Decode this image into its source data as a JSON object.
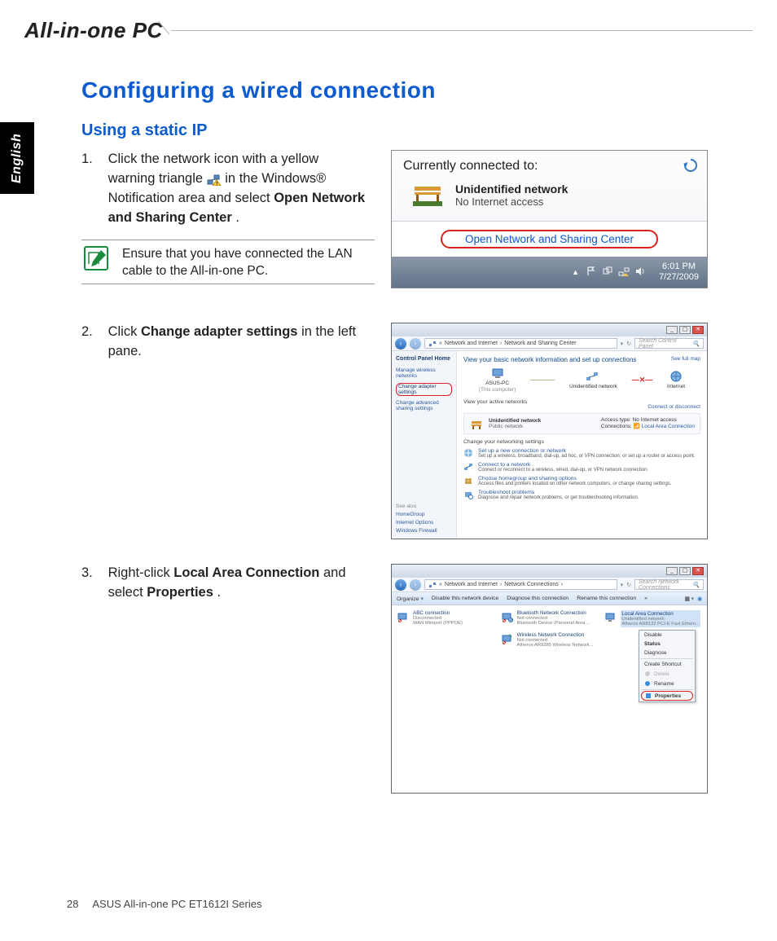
{
  "header": {
    "product_name": "All-in-one PC"
  },
  "lang_tab": "English",
  "h1": "Configuring a wired connection",
  "h2": "Using a static IP",
  "steps": {
    "s1": {
      "num": "1.",
      "text_a": "Click the network icon with a yellow warning triangle ",
      "text_b": " in the Windows® Notification area and select ",
      "bold": "Open Network and Sharing Center",
      "period": "."
    },
    "s2": {
      "num": "2.",
      "text_a": "Click ",
      "bold": "Change adapter settings",
      "text_b": " in the left pane."
    },
    "s3": {
      "num": "3.",
      "text_a": "Right-click ",
      "bold1": "Local Area Connection",
      "text_b": " and select ",
      "bold2": "Properties",
      "period": "."
    }
  },
  "note": "Ensure that you have connected the LAN cable to the All-in-one PC.",
  "shot1": {
    "title": "Currently connected to:",
    "net_name": "Unidentified network",
    "net_sub": "No Internet access",
    "link": "Open Network and Sharing Center",
    "clock_time": "6:01 PM",
    "clock_date": "7/27/2009"
  },
  "shot2": {
    "breadcrumb_a": "Network and Internet",
    "breadcrumb_b": "Network and Sharing Center",
    "search_ph": "Search Control Panel",
    "cph": "Control Panel Home",
    "left_links": {
      "manage": "Manage wireless networks",
      "change_adapter": "Change adapter settings",
      "change_adv": "Change advanced sharing settings"
    },
    "see_also": "See also",
    "see_links": {
      "hg": "HomeGroup",
      "io": "Internet Options",
      "wf": "Windows Firewall"
    },
    "main_head": "View your basic network information and set up connections",
    "see_map": "See full map",
    "node_pc": "ASUS-PC",
    "node_pc_sub": "(This computer)",
    "node_net": "Unidentified network",
    "node_inet": "Internet",
    "view_active": "View your active networks",
    "connect_disc": "Connect or disconnect",
    "active": {
      "name": "Unidentified network",
      "type": "Public network",
      "access_lbl": "Access type:",
      "access_val": "No Internet access",
      "conn_lbl": "Connections:",
      "conn_val": "Local Area Connection"
    },
    "change_head": "Change your networking settings",
    "items": {
      "i1_t": "Set up a new connection or network",
      "i1_d": "Set up a wireless, broadband, dial-up, ad hoc, or VPN connection; or set up a router or access point.",
      "i2_t": "Connect to a network",
      "i2_d": "Connect or reconnect to a wireless, wired, dial-up, or VPN network connection.",
      "i3_t": "Choose homegroup and sharing options",
      "i3_d": "Access files and printers located on other network computers, or change sharing settings.",
      "i4_t": "Troubleshoot problems",
      "i4_d": "Diagnose and repair network problems, or get troubleshooting information."
    }
  },
  "shot3": {
    "breadcrumb_a": "Network and Internet",
    "breadcrumb_b": "Network Connections",
    "search_ph": "Search Network Connections",
    "toolbar": {
      "organize": "Organize",
      "disable": "Disable this network device",
      "diagnose": "Diagnose this connection",
      "rename": "Rename this connection"
    },
    "conns": {
      "c1_n": "ABC connection",
      "c1_s1": "Disconnected",
      "c1_s2": "WAN Miniport (PPPOE)",
      "c2_n": "Bluetooth Network Connection",
      "c2_s1": "Not connected",
      "c2_s2": "Bluetooth Device (Personal Area ...",
      "c3_n": "Local Area Connection",
      "c3_s1": "Unidentified network",
      "c3_s2": "Atheros AR8132 PCI-E Fast Ethern...",
      "c4_n": "Wireless Network Connection",
      "c4_s1": "Not connected",
      "c4_s2": "Atheros AR9285 Wireless Network..."
    },
    "menu": {
      "disable": "Disable",
      "status": "Status",
      "diagnose": "Diagnose",
      "shortcut": "Create Shortcut",
      "delete": "Delete",
      "rename": "Rename",
      "properties": "Properties"
    }
  },
  "footer": {
    "page": "28",
    "text": "ASUS All-in-one PC ET1612I Series"
  }
}
